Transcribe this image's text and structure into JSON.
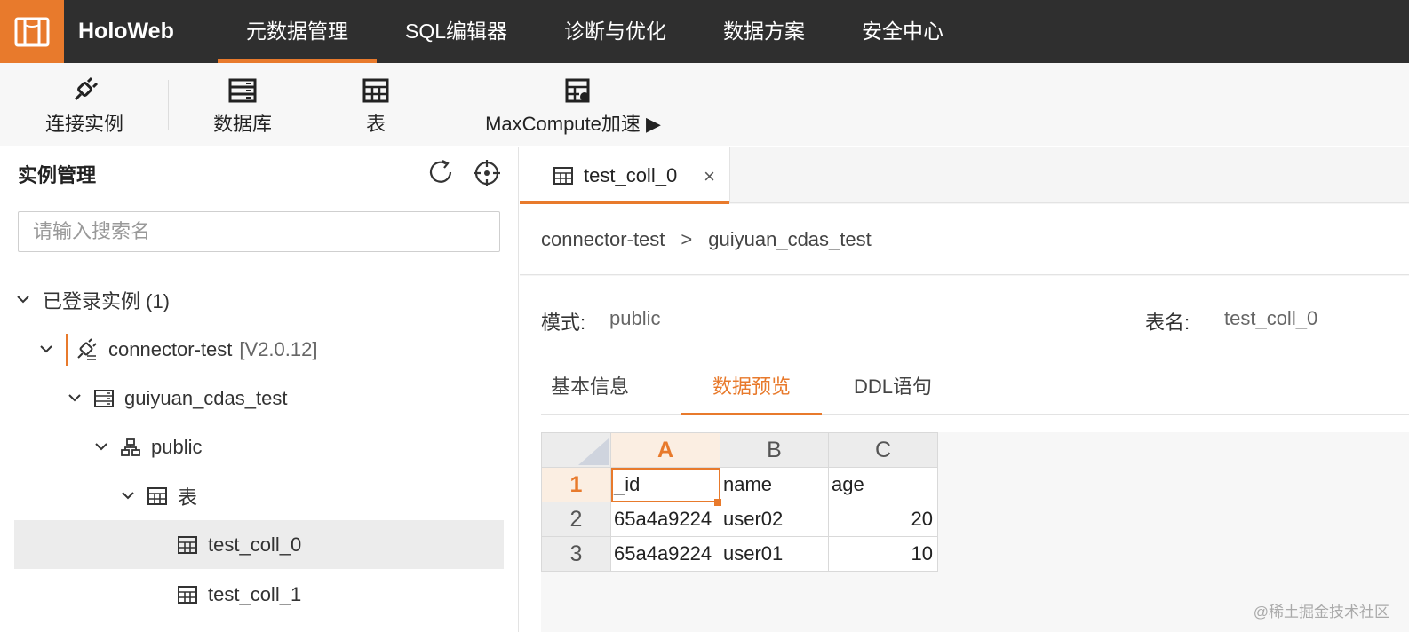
{
  "app": {
    "brand": "HoloWeb",
    "accent_color": "#e87a2c",
    "topbar_color": "#2f2f2f"
  },
  "nav": {
    "items": [
      "元数据管理",
      "SQL编辑器",
      "诊断与优化",
      "数据方案",
      "安全中心"
    ],
    "active": "元数据管理"
  },
  "toolbar": {
    "connect_label": "连接实例",
    "database_label": "数据库",
    "table_label": "表",
    "maxcompute_label": "MaxCompute加速 ▶"
  },
  "sidebar": {
    "title": "实例管理",
    "search_placeholder": "请输入搜索名",
    "logged_in_label": "已登录实例 (1)",
    "instance_name": "connector-test",
    "instance_version": "[V2.0.12]",
    "database_name": "guiyuan_cdas_test",
    "schema_name": "public",
    "table_group_label": "表",
    "tables": [
      "test_coll_0",
      "test_coll_1"
    ],
    "selected_table": "test_coll_0"
  },
  "editor": {
    "open_tab": "test_coll_0",
    "close_glyph": "×",
    "breadcrumb": [
      "connector-test",
      "guiyuan_cdas_test"
    ],
    "breadcrumb_sep": ">",
    "schema_label": "模式:",
    "schema_value": "public",
    "table_name_label": "表名:",
    "table_name_value": "test_coll_0",
    "subtabs": [
      "基本信息",
      "数据预览",
      "DDL语句"
    ],
    "active_subtab": "数据预览"
  },
  "sheet": {
    "columns": [
      "A",
      "B",
      "C"
    ],
    "row_numbers": [
      "1",
      "2",
      "3"
    ],
    "rows": [
      [
        "_id",
        "name",
        "age"
      ],
      [
        "65a4a9224",
        "user02",
        "20"
      ],
      [
        "65a4a9224",
        "user01",
        "10"
      ]
    ]
  },
  "watermark": "@稀土掘金技术社区"
}
